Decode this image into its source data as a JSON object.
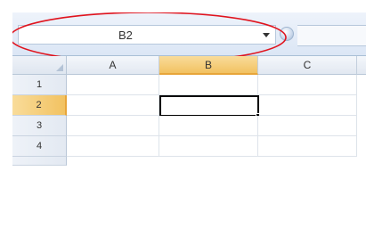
{
  "name_box": {
    "value": "B2"
  },
  "columns": [
    {
      "label": "A"
    },
    {
      "label": "B",
      "active": true
    },
    {
      "label": "C"
    }
  ],
  "rows": [
    {
      "label": "1"
    },
    {
      "label": "2",
      "active": true
    },
    {
      "label": "3"
    },
    {
      "label": "4"
    }
  ],
  "selected_cell": "B2",
  "colors": {
    "highlight_ellipse": "#e0141e",
    "active_header": "#f2c261",
    "selection_border": "#000000"
  }
}
